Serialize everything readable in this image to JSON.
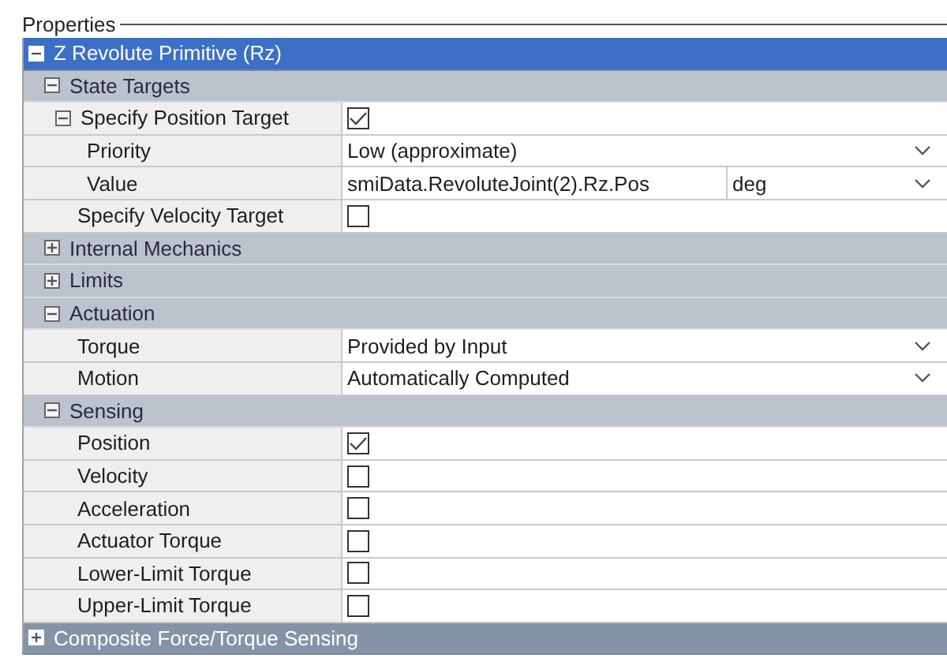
{
  "panel_title": "Properties",
  "roots": [
    {
      "label": "Z Revolute Primitive (Rz)",
      "selected": true,
      "expanded": true,
      "groups": [
        {
          "label": "State Targets",
          "expanded": true,
          "rows": [
            {
              "kind": "checkbox",
              "label": "Specify Position Target",
              "expanded": true,
              "checked": true,
              "children": [
                {
                  "kind": "dropdown",
                  "label": "Priority",
                  "value": "Low (approximate)"
                },
                {
                  "kind": "value_unit",
                  "label": "Value",
                  "value": "smiData.RevoluteJoint(2).Rz.Pos",
                  "unit": "deg"
                }
              ]
            },
            {
              "kind": "checkbox",
              "label": "Specify Velocity Target",
              "checked": false
            }
          ]
        },
        {
          "label": "Internal Mechanics",
          "expanded": false
        },
        {
          "label": "Limits",
          "expanded": false
        },
        {
          "label": "Actuation",
          "expanded": true,
          "rows": [
            {
              "kind": "dropdown",
              "label": "Torque",
              "value": "Provided by Input"
            },
            {
              "kind": "dropdown",
              "label": "Motion",
              "value": "Automatically Computed"
            }
          ]
        },
        {
          "label": "Sensing",
          "expanded": true,
          "rows": [
            {
              "kind": "checkbox",
              "label": "Position",
              "checked": true
            },
            {
              "kind": "checkbox",
              "label": "Velocity",
              "checked": false
            },
            {
              "kind": "checkbox",
              "label": "Acceleration",
              "checked": false
            },
            {
              "kind": "checkbox",
              "label": "Actuator Torque",
              "checked": false
            },
            {
              "kind": "checkbox",
              "label": "Lower-Limit Torque",
              "checked": false
            },
            {
              "kind": "checkbox",
              "label": "Upper-Limit Torque",
              "checked": false
            }
          ]
        }
      ]
    },
    {
      "label": "Composite Force/Torque Sensing",
      "selected": false,
      "expanded": false
    }
  ]
}
